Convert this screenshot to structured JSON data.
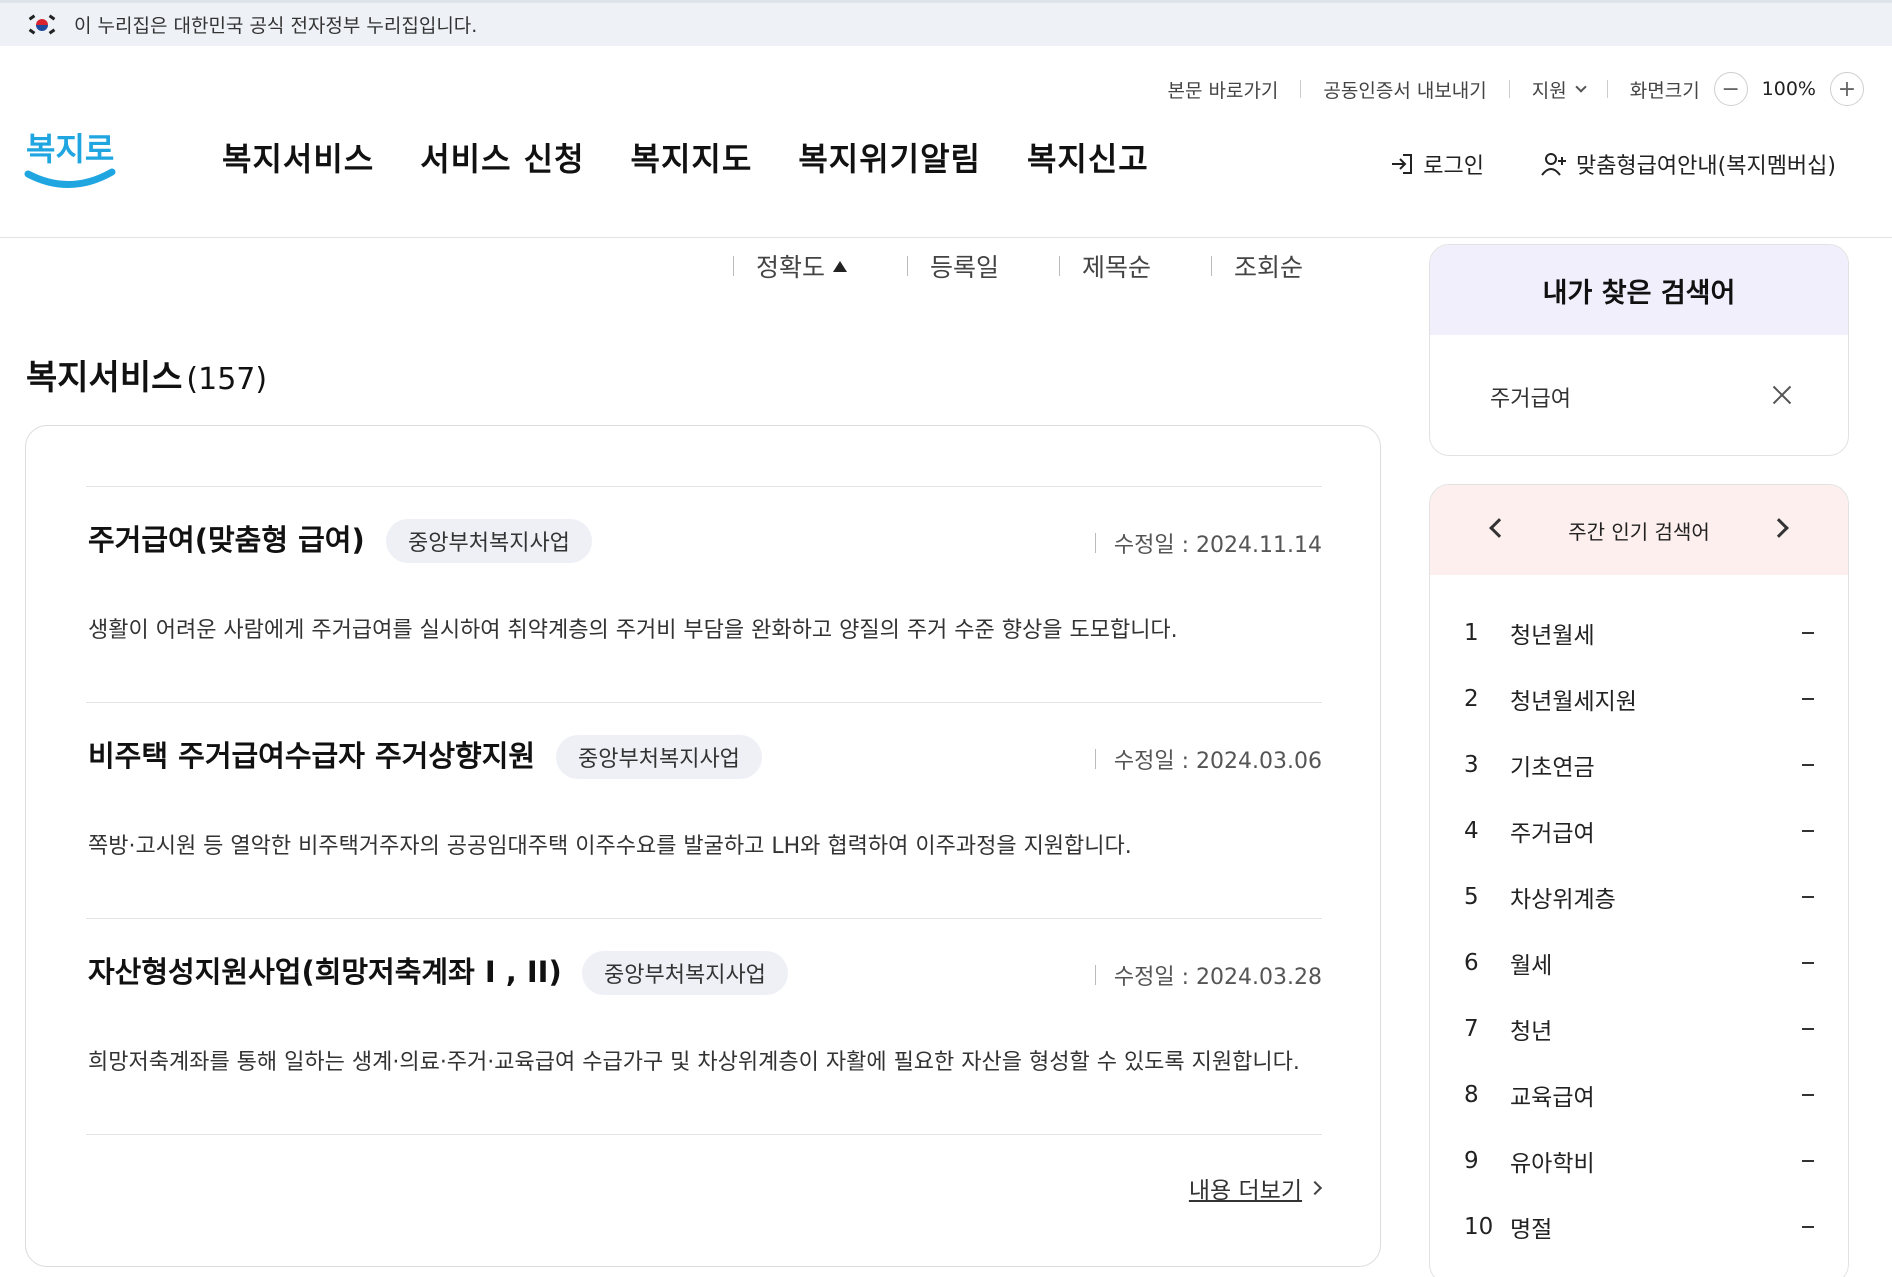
{
  "gov_banner": {
    "text": "이 누리집은 대한민국 공식 전자정부 누리집입니다."
  },
  "utility": {
    "skip_to_content": "본문 바로가기",
    "cert_export": "공동인증서 내보내기",
    "support": "지원",
    "screen_size": "화면크기",
    "zoom_value": "100%",
    "zoom_out": "−",
    "zoom_in": "+"
  },
  "logo": {
    "text": "복지로",
    "brand_color": "#1fa6e0"
  },
  "gnb": [
    "복지서비스",
    "서비스 신청",
    "복지지도",
    "복지위기알림",
    "복지신고"
  ],
  "member": {
    "login": "로그인",
    "membership": "맞춤형급여안내(복지멤버십)"
  },
  "sort": [
    "정확도",
    "등록일",
    "제목순",
    "조회순"
  ],
  "section": {
    "title": "복지서비스",
    "count": "(157)"
  },
  "results": [
    {
      "title": "주거급여(맞춤형 급여)",
      "badge": "중앙부처복지사업",
      "date": "수정일 : 2024.11.14",
      "desc": "생활이 어려운 사람에게 주거급여를 실시하여 취약계층의 주거비 부담을 완화하고 양질의 주거 수준 향상을 도모합니다."
    },
    {
      "title": "비주택 주거급여수급자 주거상향지원",
      "badge": "중앙부처복지사업",
      "date": "수정일 : 2024.03.06",
      "desc": "쪽방·고시원 등 열악한 비주택거주자의 공공임대주택 이주수요를 발굴하고 LH와 협력하여 이주과정을 지원합니다."
    },
    {
      "title": "자산형성지원사업(희망저축계좌 I , II)",
      "badge": "중앙부처복지사업",
      "date": "수정일 : 2024.03.28",
      "desc": "희망저축계좌를 통해 일하는 생계·의료·주거·교육급여 수급가구 및 차상위계층이 자활에 필요한 자산을 형성할 수 있도록 지원합니다."
    }
  ],
  "more_link": "내용 더보기",
  "my_search": {
    "title": "내가 찾은 검색어",
    "term": "주거급여"
  },
  "popular": {
    "title": "주간 인기 검색어",
    "items": [
      {
        "rank": "1",
        "keyword": "청년월세"
      },
      {
        "rank": "2",
        "keyword": "청년월세지원"
      },
      {
        "rank": "3",
        "keyword": "기초연금"
      },
      {
        "rank": "4",
        "keyword": "주거급여"
      },
      {
        "rank": "5",
        "keyword": "차상위계층"
      },
      {
        "rank": "6",
        "keyword": "월세"
      },
      {
        "rank": "7",
        "keyword": "청년"
      },
      {
        "rank": "8",
        "keyword": "교육급여"
      },
      {
        "rank": "9",
        "keyword": "유아학비"
      },
      {
        "rank": "10",
        "keyword": "명절"
      }
    ]
  }
}
